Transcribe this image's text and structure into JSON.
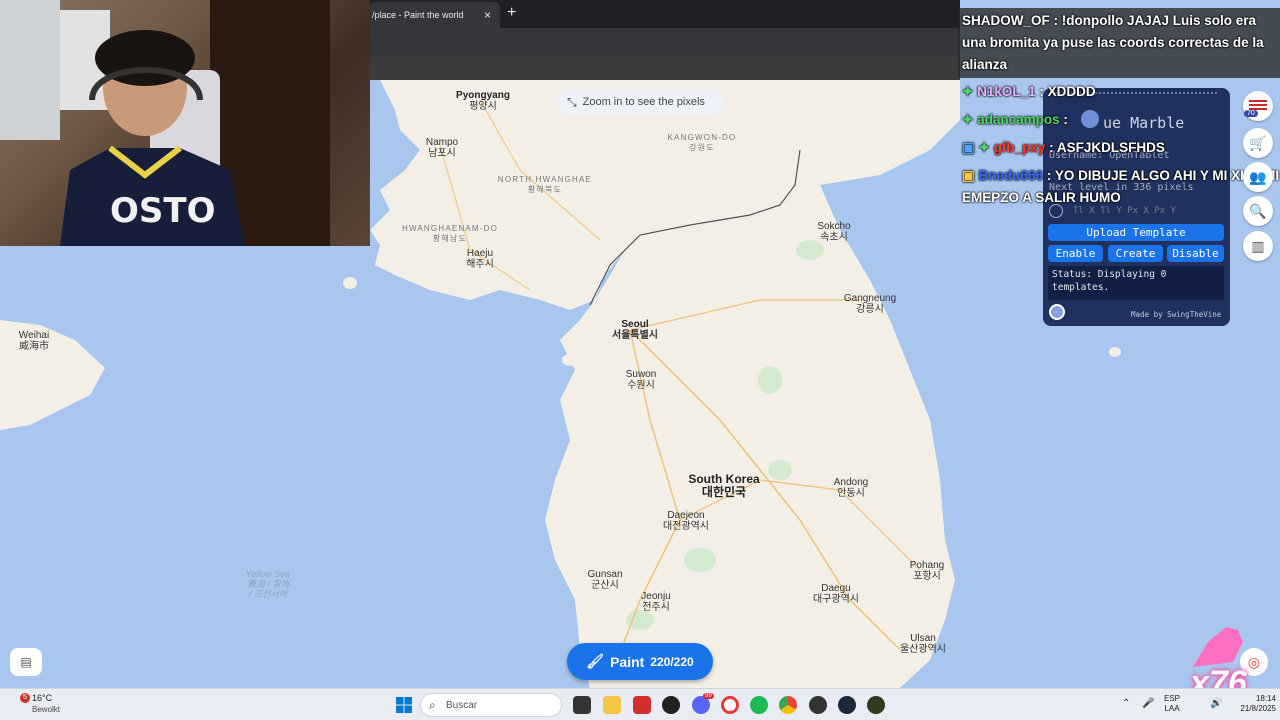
{
  "browser": {
    "tab_title": "/place - Paint the world",
    "tab_close": "×",
    "new_tab": "+"
  },
  "map": {
    "zoom_hint": "Zoom in to see the pixels",
    "cities": [
      {
        "id": "pyongyang",
        "en": "Pyongyang",
        "ko": "평양시"
      },
      {
        "id": "nampo",
        "en": "Nampo",
        "ko": "남포시"
      },
      {
        "id": "haeju",
        "en": "Haeju",
        "ko": "해주시"
      },
      {
        "id": "sokcho",
        "en": "Sokcho",
        "ko": "속초시"
      },
      {
        "id": "seoul",
        "en": "Seoul",
        "ko": "서울특별시"
      },
      {
        "id": "gangneung",
        "en": "Gangneung",
        "ko": "강릉시"
      },
      {
        "id": "suwon",
        "en": "Suwon",
        "ko": "수원시"
      },
      {
        "id": "weihai",
        "en": "Weihai",
        "ko": "威海市"
      },
      {
        "id": "andong",
        "en": "Andong",
        "ko": "안동시"
      },
      {
        "id": "daejeon",
        "en": "Daejeon",
        "ko": "대전광역시"
      },
      {
        "id": "gunsan",
        "en": "Gunsan",
        "ko": "군산시"
      },
      {
        "id": "jeonju",
        "en": "Jeonju",
        "ko": "전주시"
      },
      {
        "id": "pohang",
        "en": "Pohang",
        "ko": "포항시"
      },
      {
        "id": "daegu",
        "en": "Daegu",
        "ko": "대구광역시"
      },
      {
        "id": "ulsan",
        "en": "Ulsan",
        "ko": "울산광역시"
      }
    ],
    "regions": [
      {
        "id": "kangwon",
        "en": "KANGWON-DO",
        "ko": "강원도"
      },
      {
        "id": "north-hwanghae",
        "en": "NORTH HWANGHAE",
        "ko": "황해북도"
      },
      {
        "id": "south-hwanghae",
        "en": "HWANGHAENAM-DO",
        "ko": "황해남도"
      }
    ],
    "country": {
      "en": "South Korea",
      "ko": "대한민국"
    },
    "sea": {
      "line1": "Yellow Sea",
      "line2": "黃海 / 황해",
      "line3": "/ 조선서해"
    }
  },
  "chat": [
    {
      "user": "SHADOW_OF",
      "user_color": "#ffffff",
      "text": ": !donpollo JAJAJ Luis solo era una bromita ya puse las coords correctas de la alianza"
    },
    {
      "user": "N1kOL_1",
      "user_color": "#e2b3ff",
      "text": ": XDDDD"
    },
    {
      "user": "adancampos",
      "user_color": "#4cd964",
      "text": ":"
    },
    {
      "user": "gfb_pxy",
      "user_color": "#ff3b30",
      "text": ": ASFJKDLSFHDS"
    },
    {
      "user": "Bnedu666",
      "user_color": "#3a6bff",
      "text": ": YO DIBUJE ALGO AHI Y MI XIAOMI EMEPZO A SALIR HUMO"
    }
  ],
  "blue_marble": {
    "title": "ue Marble",
    "username": "Username: OpenTablet",
    "next_level": "Next level in 336 pixels",
    "coords": "Tl X  Tl Y  Px X  Px Y",
    "upload": "Upload Template",
    "enable": "Enable",
    "create": "Create",
    "disable": "Disable",
    "status": "Status: Displaying 0 templates.",
    "made_by": "Made by SwingTheVine"
  },
  "side_badge": "70",
  "paint": {
    "label": "Paint",
    "count": "220/220"
  },
  "overlay_counter": "x76",
  "taskbar": {
    "weather_temp": "16°C",
    "weather_cond": "Bewolkt",
    "weather_badge": "5",
    "search_placeholder": "Buscar",
    "lang_1": "ESP",
    "lang_2": "LAA",
    "time": "18:14",
    "date": "21/8/2025",
    "discord_badge": "99"
  }
}
